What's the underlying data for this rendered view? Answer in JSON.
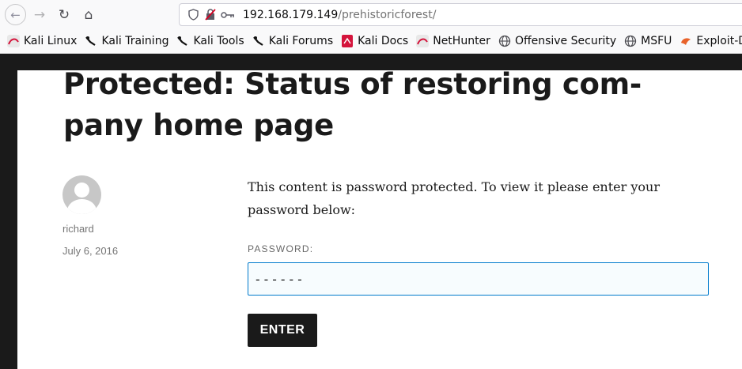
{
  "browser": {
    "url_host": "192.168.179.149",
    "url_path": "/prehistoricforest/",
    "bookmarks": [
      {
        "label": "Kali Linux",
        "icon": "kali-icon"
      },
      {
        "label": "Kali Training",
        "icon": "kali-dragon-icon"
      },
      {
        "label": "Kali Tools",
        "icon": "kali-dragon-icon"
      },
      {
        "label": "Kali Forums",
        "icon": "kali-dragon-icon"
      },
      {
        "label": "Kali Docs",
        "icon": "kali-docs-icon"
      },
      {
        "label": "NetHunter",
        "icon": "kali-icon"
      },
      {
        "label": "Offensive Security",
        "icon": "globe-icon"
      },
      {
        "label": "MSFU",
        "icon": "globe-icon"
      },
      {
        "label": "Exploit-DB",
        "icon": "exploitdb-icon"
      }
    ]
  },
  "post": {
    "title": "Protected: Status of restoring com-pany home page",
    "author": "richard",
    "date": "July 6, 2016",
    "message": "This content is password protected. To view it please enter your password below:",
    "password_label": "PASSWORD:",
    "password_value": "------",
    "submit_label": "ENTER"
  },
  "colors": {
    "page_bg": "#ffffff",
    "frame_bg": "#1a1a1a",
    "input_border": "#007acc",
    "button_bg": "#1a1a1a"
  }
}
